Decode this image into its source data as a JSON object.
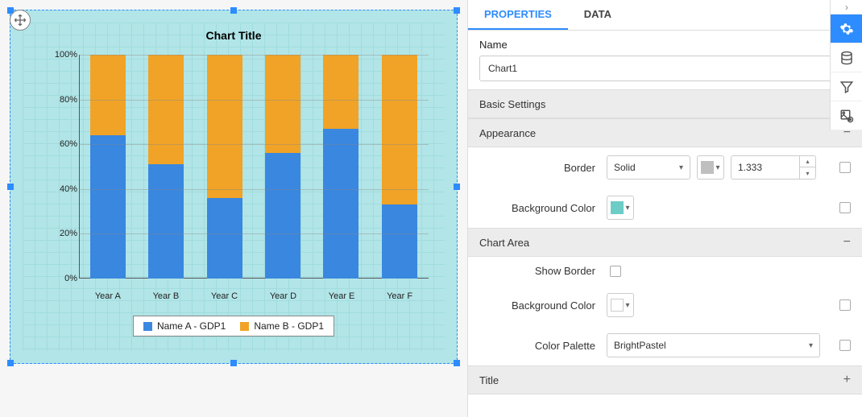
{
  "chart_data": {
    "type": "bar",
    "stacked": true,
    "title": "Chart Title",
    "categories": [
      "Year A",
      "Year B",
      "Year C",
      "Year D",
      "Year E",
      "Year F"
    ],
    "series": [
      {
        "name": "Name A - GDP1",
        "color": "#3a87e0",
        "values": [
          64,
          51,
          36,
          56,
          67,
          33
        ]
      },
      {
        "name": "Name B - GDP1",
        "color": "#f0a326",
        "values": [
          36,
          49,
          64,
          44,
          33,
          67
        ]
      }
    ],
    "y_ticks": [
      "0%",
      "20%",
      "40%",
      "60%",
      "80%",
      "100%"
    ],
    "ylabel": "",
    "xlabel": "",
    "ylim": [
      0,
      100
    ]
  },
  "panel": {
    "tabs": {
      "properties": "PROPERTIES",
      "data": "DATA"
    },
    "name_label": "Name",
    "name_value": "Chart1",
    "sections": {
      "basic": "Basic Settings",
      "appearance": "Appearance",
      "chart_area": "Chart Area",
      "title": "Title"
    },
    "appearance": {
      "border_label": "Border",
      "border_style": "Solid",
      "border_color": "#bfbfbf",
      "border_width": "1.333",
      "background_label": "Background Color",
      "background_color": "#6cccc6"
    },
    "chart_area": {
      "show_border_label": "Show Border",
      "background_label": "Background Color",
      "background_color": "#ffffff",
      "palette_label": "Color Palette",
      "palette_value": "BrightPastel"
    }
  }
}
